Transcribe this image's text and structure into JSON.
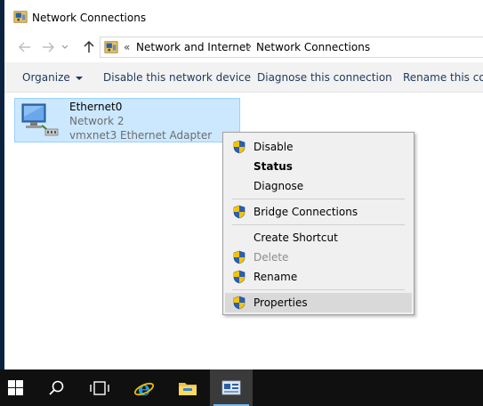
{
  "window": {
    "title": "Network Connections"
  },
  "address_bar": {
    "overflow": "«",
    "crumbs": [
      "Network and Internet",
      "Network Connections"
    ]
  },
  "toolbar": {
    "organize": "Organize",
    "disable": "Disable this network device",
    "diagnose": "Diagnose this connection",
    "rename": "Rename this connection"
  },
  "adapter": {
    "name": "Ethernet0",
    "network": "Network  2",
    "device": "vmxnet3 Ethernet Adapter"
  },
  "context_menu": {
    "items": [
      {
        "label": "Disable",
        "shield": true
      },
      {
        "label": "Status",
        "bold": true
      },
      {
        "label": "Diagnose"
      },
      {
        "label": "Bridge Connections",
        "shield": true
      },
      {
        "label": "Create Shortcut"
      },
      {
        "label": "Delete",
        "shield": true,
        "disabled": true
      },
      {
        "label": "Rename",
        "shield": true
      },
      {
        "label": "Properties",
        "shield": true,
        "highlighted": true
      }
    ]
  },
  "taskbar": {
    "icons": [
      "windows-start-icon",
      "search-icon",
      "task-view-icon",
      "internet-explorer-icon",
      "file-explorer-icon",
      "network-connections-icon"
    ],
    "active": "network-connections-icon"
  },
  "colors": {
    "selection_bg": "#cce8ff",
    "selection_border": "#99d1ff",
    "toolbar_text": "#1e395b",
    "menu_bg": "#f0f0f0",
    "taskbar_bg": "#101010",
    "shield_blue": "#2b5fb3",
    "shield_yellow": "#f5c400"
  }
}
